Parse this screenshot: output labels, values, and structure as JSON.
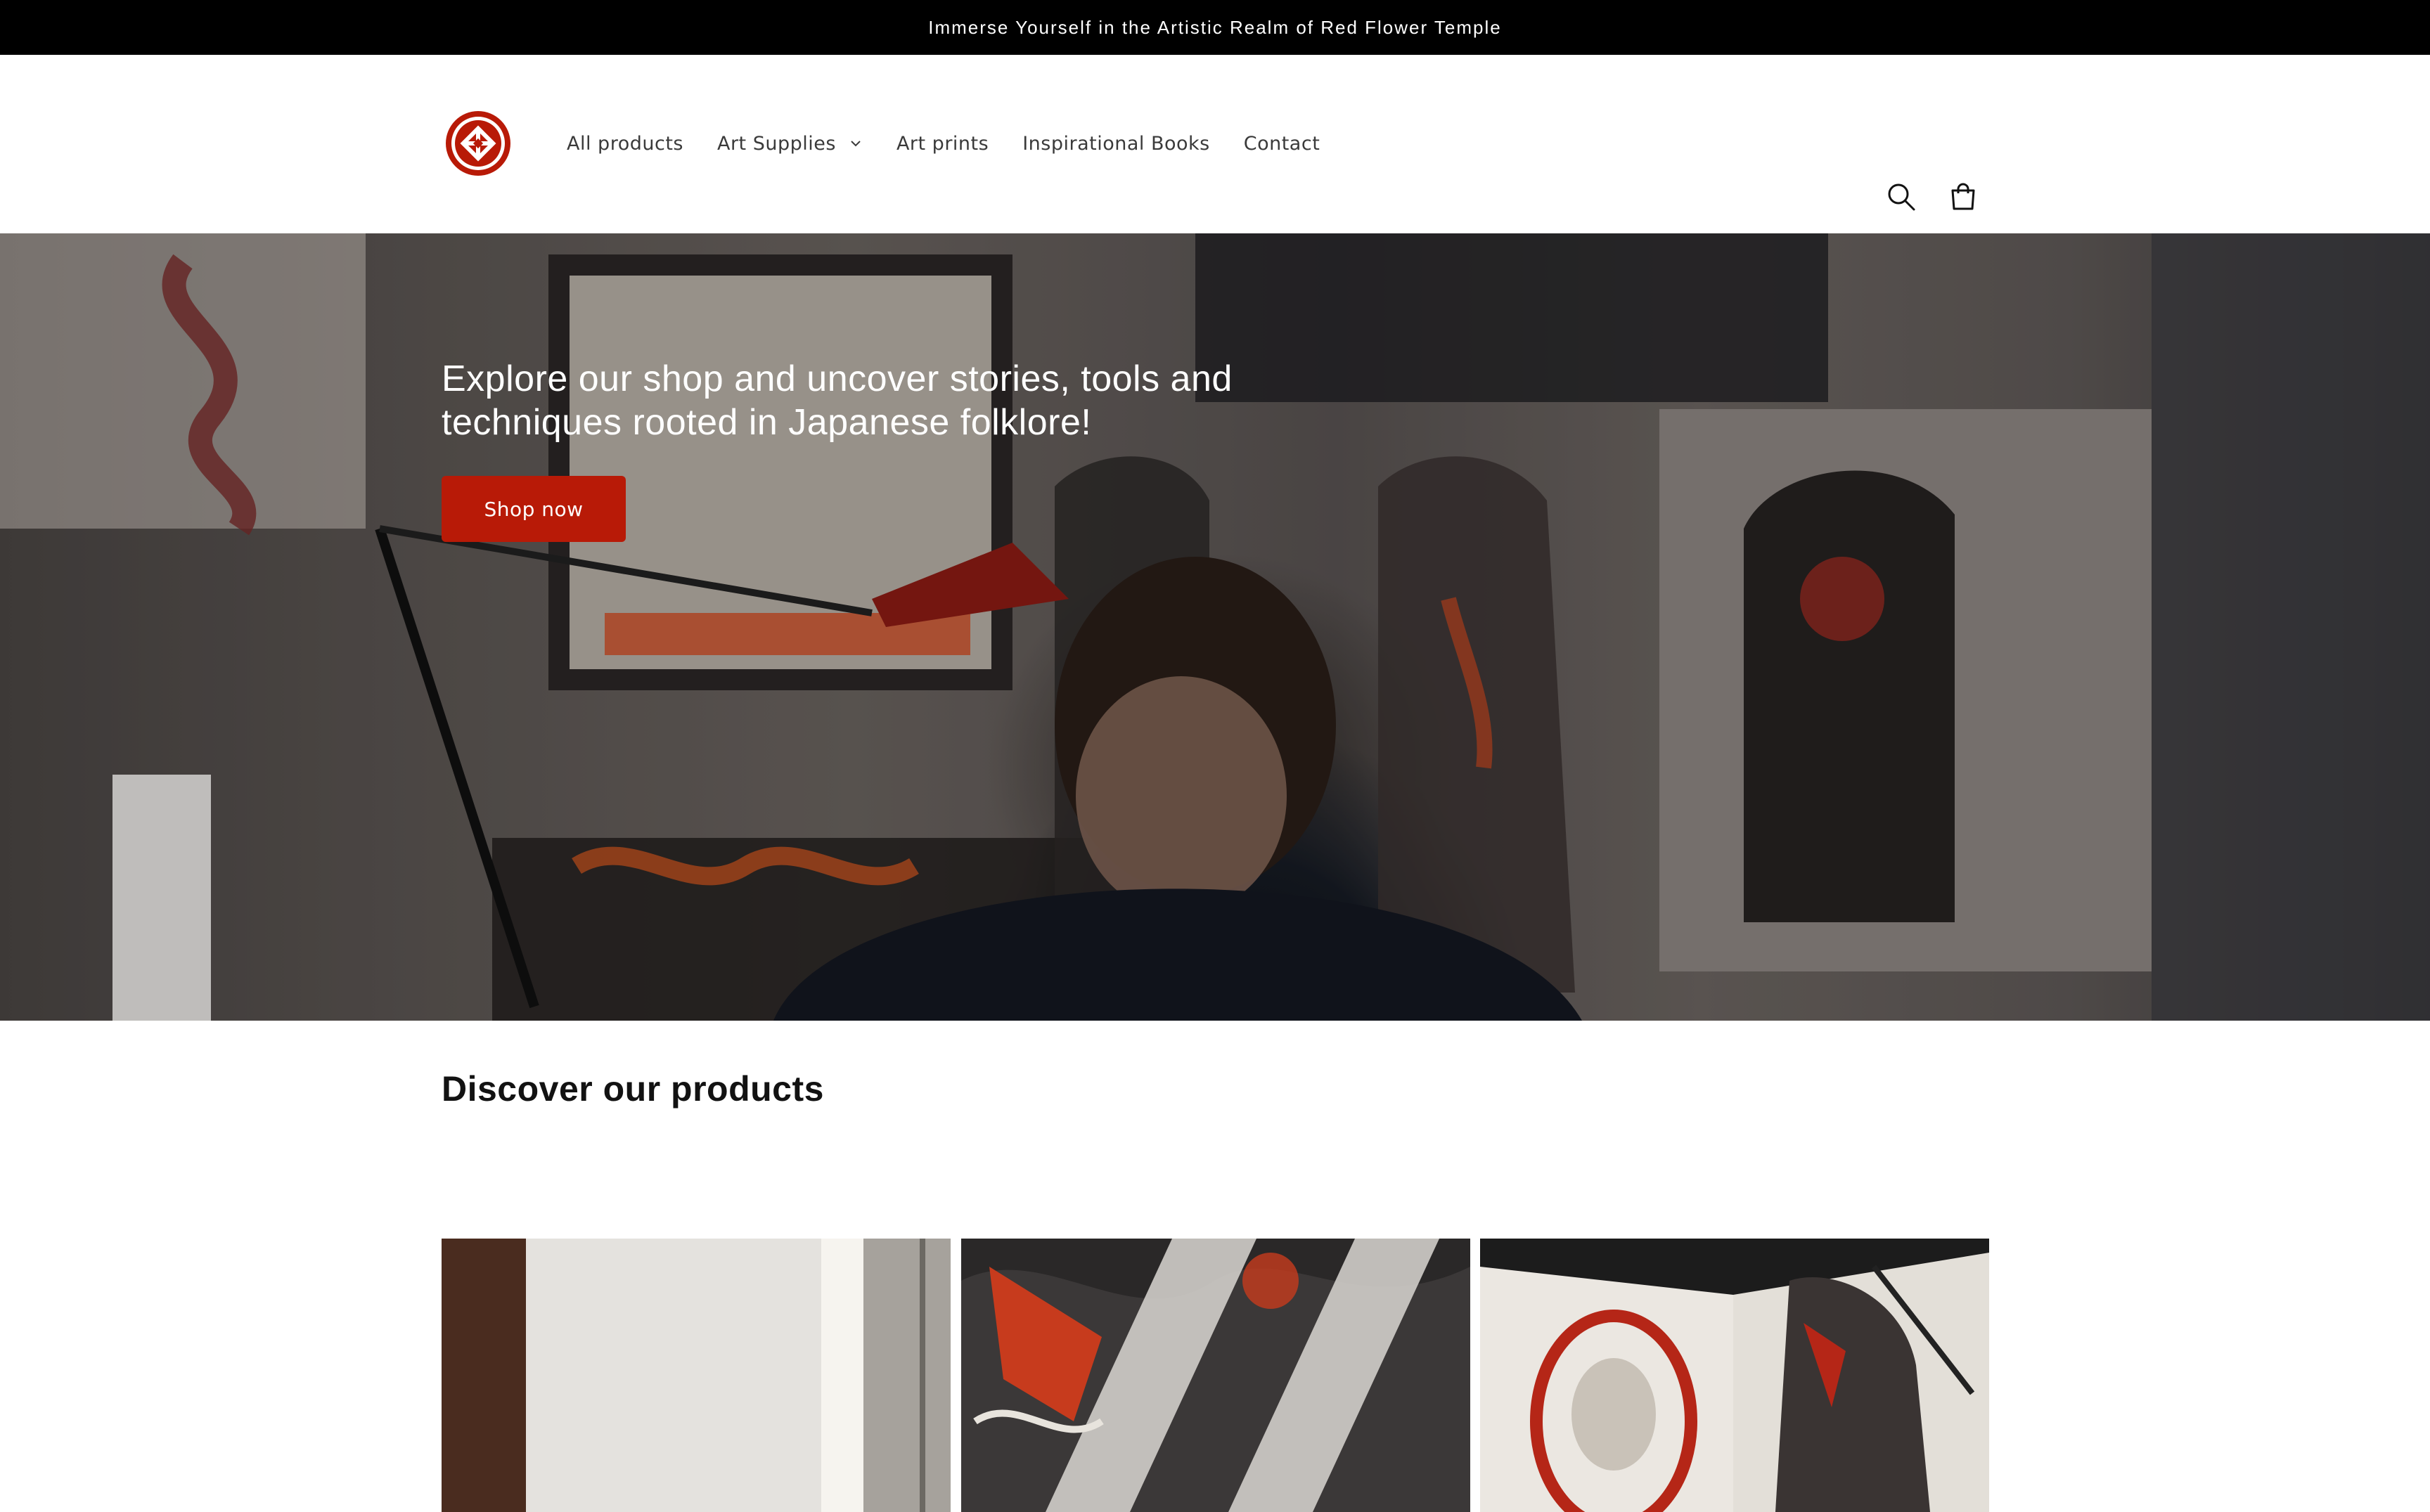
{
  "announcement": {
    "text": "Immerse Yourself in the Artistic Realm of Red Flower Temple"
  },
  "header": {
    "logo_icon": "red-flower-temple-logo",
    "nav": [
      {
        "label": "All products"
      },
      {
        "label": "Art Supplies",
        "has_dropdown": true
      },
      {
        "label": "Art prints"
      },
      {
        "label": "Inspirational Books"
      },
      {
        "label": "Contact"
      }
    ],
    "icons": [
      "search-icon",
      "cart-icon"
    ]
  },
  "hero": {
    "heading": "Explore our shop and uncover stories, tools and techniques rooted in Japanese folklore!",
    "button_label": "Shop now"
  },
  "products_section": {
    "title": "Discover our products"
  },
  "colors": {
    "accent": "#b81a07",
    "announcement_bg": "#000000",
    "text": "#121212"
  }
}
